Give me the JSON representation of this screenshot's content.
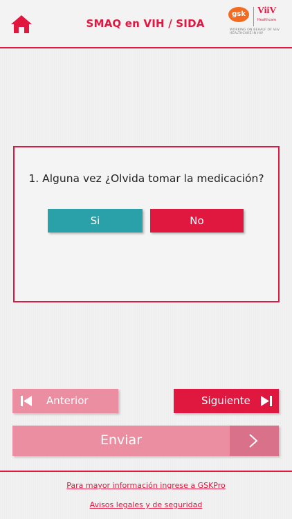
{
  "header": {
    "title": "SMAQ en VIH / SIDA",
    "home_icon": "home-icon",
    "logo": {
      "gsk": "gsk",
      "viiv": "ViiV",
      "viiv_sub": "Healthcare",
      "tagline": "WORKING ON BEHALF OF ViiV HEALTHCARE IN HIV"
    }
  },
  "question": {
    "text": "1. Alguna vez ¿Olvida tomar la medicación?",
    "options": [
      "Si",
      "No"
    ]
  },
  "navigation": {
    "prev_label": "Anterior",
    "next_label": "Siguiente",
    "send_label": "Enviar"
  },
  "footer": {
    "link_gskpro": "Para mayor información ingrese a GSKPro",
    "link_legal": "Avisos legales y de seguridad"
  },
  "colors": {
    "brand_red": "#e0173f",
    "teal": "#2aa1a8",
    "pink_disabled": "#ec8ea1",
    "background": "#f1f1f1"
  }
}
